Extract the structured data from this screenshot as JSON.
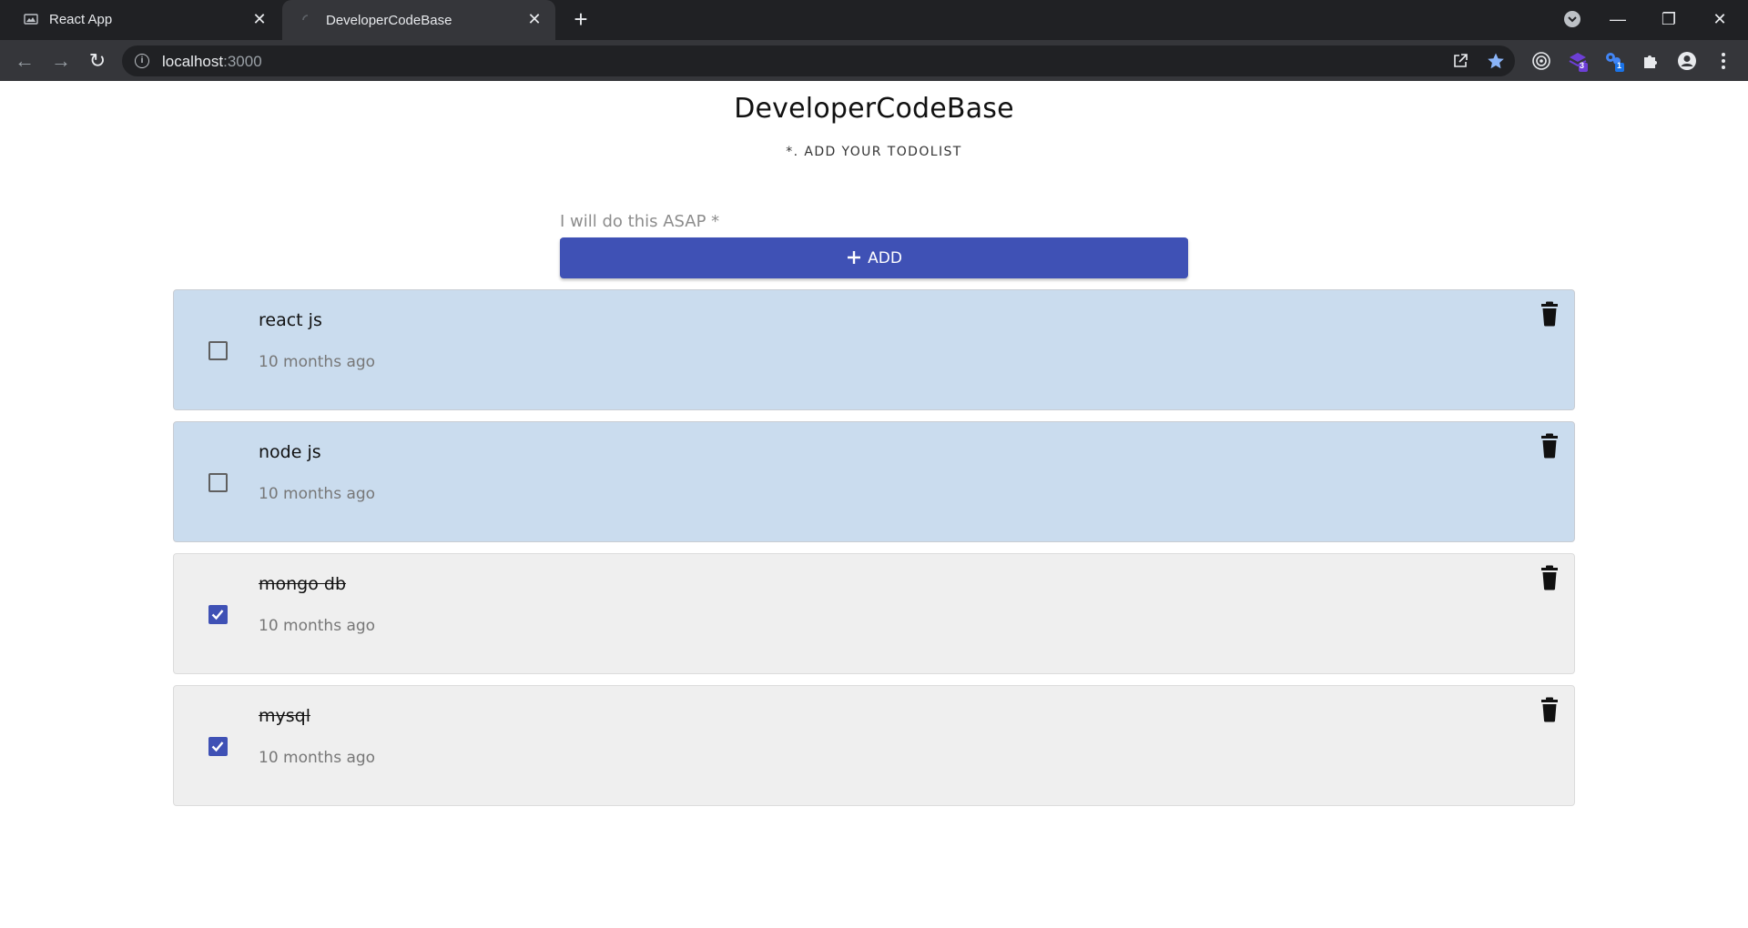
{
  "browser": {
    "tabs": [
      {
        "label": "React App",
        "active": false
      },
      {
        "label": "DeveloperCodeBase",
        "active": true
      }
    ],
    "url_host": "localhost",
    "url_port": ":3000",
    "extension_badges": [
      "3",
      "1"
    ]
  },
  "app": {
    "title": "DeveloperCodeBase",
    "subtitle": "*. ADD YOUR TODOLIST",
    "input_placeholder": "I will do this ASAP *",
    "add_button_label": "ADD",
    "accent_color": "#3f51b5",
    "todos": [
      {
        "text": "react js",
        "time": "10 months ago",
        "completed": false
      },
      {
        "text": "node js",
        "time": "10 months ago",
        "completed": false
      },
      {
        "text": "mongo db",
        "time": "10 months ago",
        "completed": true
      },
      {
        "text": "mysql",
        "time": "10 months ago",
        "completed": true
      }
    ]
  }
}
